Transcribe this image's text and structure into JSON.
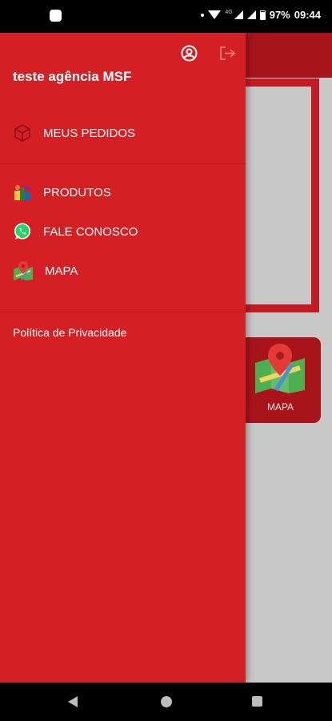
{
  "status_bar": {
    "network_type": "4G",
    "battery": "97%",
    "time": "09:44"
  },
  "drawer": {
    "user_name": "teste agência MSF",
    "icons": {
      "profile": "account-circle-icon",
      "logout": "logout-icon"
    },
    "primary_items": [
      {
        "label": "MEUS PEDIDOS",
        "icon": "package-icon"
      }
    ],
    "secondary_items": [
      {
        "label": "PRODUTOS",
        "icon": "products-icon"
      },
      {
        "label": "FALE CONOSCO",
        "icon": "whatsapp-icon"
      },
      {
        "label": "MAPA",
        "icon": "map-icon"
      }
    ],
    "policy_link": "Política de Privacidade"
  },
  "background": {
    "map_card_label": "MAPA"
  },
  "colors": {
    "drawer_bg": "#d42024",
    "header_bg": "#a9141a",
    "background": "#c8c8c8"
  }
}
